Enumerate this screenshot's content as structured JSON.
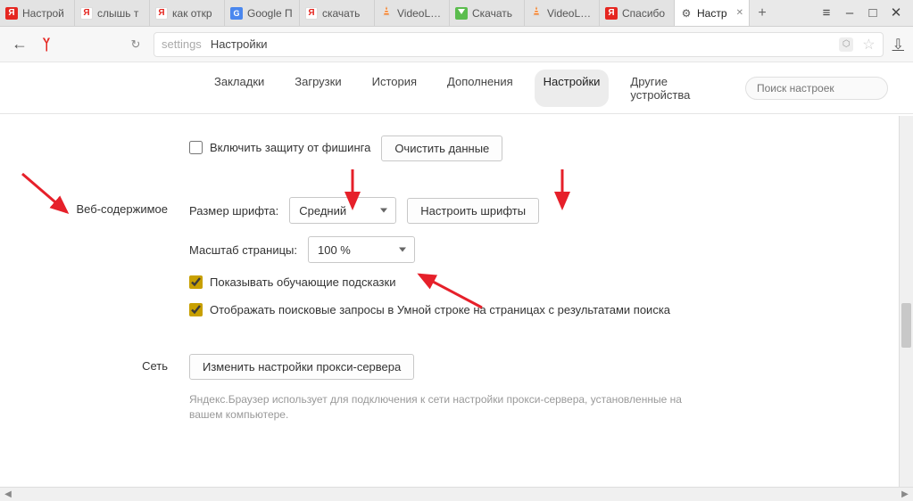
{
  "window": {
    "menu_icon": "≡",
    "minimize": "–",
    "maximize": "□",
    "close": "✕"
  },
  "tabs": [
    {
      "label": "Настрой",
      "icon": "yandex"
    },
    {
      "label": "слышь т",
      "icon": "yandex-white"
    },
    {
      "label": "как откр",
      "icon": "yandex-white"
    },
    {
      "label": "Google П",
      "icon": "google"
    },
    {
      "label": "скачать",
      "icon": "yandex-white"
    },
    {
      "label": "VideoLAN",
      "icon": "vlc"
    },
    {
      "label": "Скачать",
      "icon": "fdm"
    },
    {
      "label": "VideoLAN",
      "icon": "vlc"
    },
    {
      "label": "Спасибо",
      "icon": "yandex"
    },
    {
      "label": "Настр",
      "icon": "gear",
      "active": true
    }
  ],
  "newtab": "+",
  "addressbar": {
    "back": "←",
    "reload": "↻",
    "path": "settings",
    "title": "Настройки",
    "star": "☆",
    "download": "⇩"
  },
  "settings_nav": {
    "items": [
      "Закладки",
      "Загрузки",
      "История",
      "Дополнения",
      "Настройки",
      "Другие устройства"
    ],
    "selected_index": 4,
    "search_placeholder": "Поиск настроек"
  },
  "phishing": {
    "checkbox_label": "Включить защиту от фишинга",
    "clear_button": "Очистить данные"
  },
  "web_content": {
    "section_title": "Веб-содержимое",
    "font_size_label": "Размер шрифта:",
    "font_size_value": "Средний",
    "font_settings_button": "Настроить шрифты",
    "zoom_label": "Масштаб страницы:",
    "zoom_value": "100 %",
    "hints_checkbox": "Показывать обучающие подсказки",
    "smartline_checkbox": "Отображать поисковые запросы в Умной строке на страницах с результатами поиска"
  },
  "network": {
    "section_title": "Сеть",
    "proxy_button": "Изменить настройки прокси-сервера",
    "proxy_hint": "Яндекс.Браузер использует для подключения к сети настройки прокси-сервера, установленные на вашем компьютере."
  }
}
